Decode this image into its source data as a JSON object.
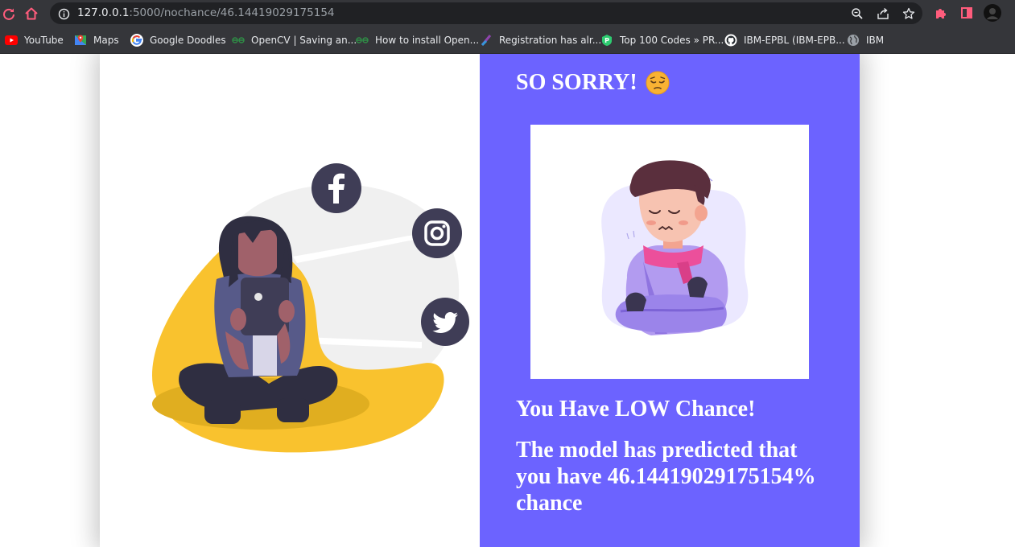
{
  "browser": {
    "url_host": "127.0.0.1",
    "url_path": ":5000/nochance/46.14419029175154",
    "bookmarks": [
      {
        "label": "YouTube",
        "icon": "youtube-icon"
      },
      {
        "label": "Maps",
        "icon": "maps-icon"
      },
      {
        "label": "Google Doodles",
        "icon": "google-icon"
      },
      {
        "label": "OpenCV | Saving an...",
        "icon": "geeksforgeeks-icon"
      },
      {
        "label": "How to install Open...",
        "icon": "geeksforgeeks-icon"
      },
      {
        "label": "Registration has alr...",
        "icon": "registration-icon"
      },
      {
        "label": "Top 100 Codes » PR...",
        "icon": "shield-icon"
      },
      {
        "label": "IBM-EPBL (IBM-EPB...",
        "icon": "github-icon"
      },
      {
        "label": "IBM",
        "icon": "globe-icon"
      }
    ]
  },
  "page": {
    "heading": "SO SORRY!",
    "heading_emoji": "pensive-face-icon",
    "subheading": "You Have LOW Chance!",
    "message": "The model has predicted that you have 46.14419029175154% chance"
  },
  "colors": {
    "panel": "#6c63ff",
    "chrome": "#35363a",
    "omnibox": "#202124",
    "accent_yellow": "#f9c22e",
    "icon_dark": "#3f3d56"
  }
}
